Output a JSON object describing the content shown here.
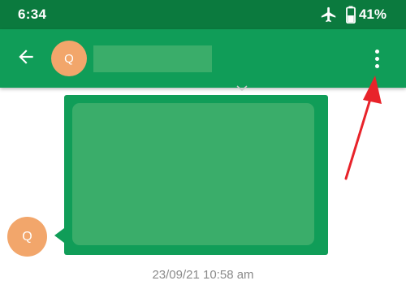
{
  "status_bar": {
    "time": "6:34",
    "battery_percent": "41%",
    "icons": [
      "airplane-mode-icon",
      "battery-icon"
    ]
  },
  "app_bar": {
    "back_icon": "arrow-back-icon",
    "contact_initial": "Q",
    "overflow_icon": "more-vert-icon"
  },
  "conversation": {
    "sender_initial": "Q",
    "timestamp": "23/09/21 10:58 am"
  },
  "colors": {
    "status_bar": "#0b7a3e",
    "app_bar": "#109d58",
    "redaction": "#3aad6a",
    "avatar": "#f2a66b",
    "annotation_arrow": "#e8232a",
    "timestamp_text": "#8a8a8a"
  }
}
